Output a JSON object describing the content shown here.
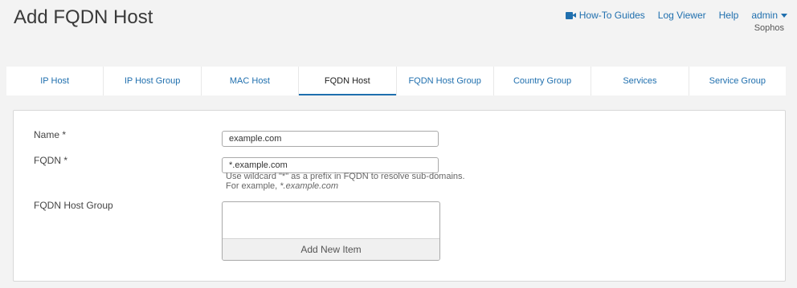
{
  "page": {
    "title": "Add FQDN Host"
  },
  "header": {
    "howto_label": "How-To Guides",
    "logviewer_label": "Log Viewer",
    "help_label": "Help",
    "user_label": "admin",
    "org_label": "Sophos"
  },
  "tabs": [
    {
      "label": "IP Host"
    },
    {
      "label": "IP Host Group"
    },
    {
      "label": "MAC Host"
    },
    {
      "label": "FQDN Host"
    },
    {
      "label": "FQDN Host Group"
    },
    {
      "label": "Country Group"
    },
    {
      "label": "Services"
    },
    {
      "label": "Service Group"
    }
  ],
  "active_tab": "FQDN Host",
  "form": {
    "name": {
      "label": "Name *",
      "value": "example.com"
    },
    "fqdn": {
      "label": "FQDN *",
      "value": "*.example.com",
      "hint_line1": "Use wildcard \"*\" as a prefix in FQDN to resolve sub-domains.",
      "hint_line2_prefix": "For example, ",
      "hint_line2_example": "*.example.com"
    },
    "group": {
      "label": "FQDN Host Group",
      "add_label": "Add New Item"
    }
  },
  "colors": {
    "link": "#1f6fae",
    "background": "#f3f3f3"
  },
  "icons": {
    "howto": "video-camera-icon",
    "user_menu": "caret-down-icon"
  }
}
